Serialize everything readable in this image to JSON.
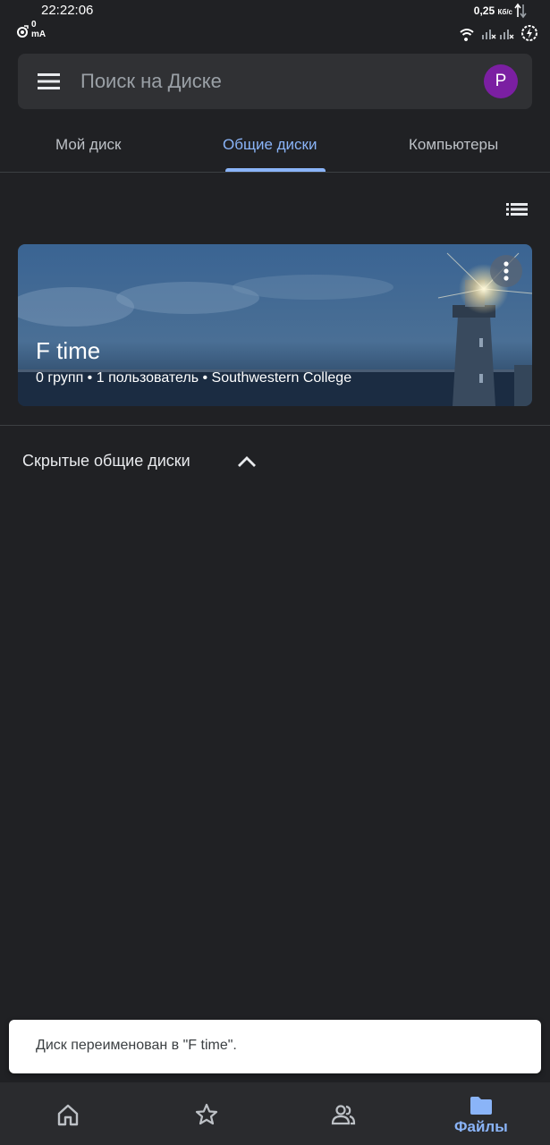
{
  "status_bar": {
    "time": "22:22:06",
    "current_value": "0",
    "current_unit": "mA",
    "net_speed": "0,25",
    "net_speed_unit": "Кб/с",
    "icons": [
      "wifi-icon",
      "signal-icon",
      "signal-icon",
      "battery-charging-icon"
    ]
  },
  "search": {
    "placeholder": "Поиск на Диске",
    "avatar_letter": "P",
    "avatar_color": "#7b1fa2"
  },
  "tabs": [
    {
      "label": "Мой диск",
      "active": false
    },
    {
      "label": "Общие диски",
      "active": true
    },
    {
      "label": "Компьютеры",
      "active": false
    }
  ],
  "shared_drive": {
    "name": "F time",
    "meta": "0 групп • 1 пользователь • Southwestern College"
  },
  "hidden_section": {
    "title": "Скрытые общие диски"
  },
  "snackbar": {
    "message": "Диск переименован в \"F time\"."
  },
  "bottom_nav": [
    {
      "icon": "home-icon",
      "label": ""
    },
    {
      "icon": "star-icon",
      "label": ""
    },
    {
      "icon": "people-icon",
      "label": ""
    },
    {
      "icon": "folder-icon",
      "label": "Файлы",
      "active": true
    }
  ],
  "colors": {
    "background": "#202124",
    "accent": "#8ab4f8",
    "surface": "#303134"
  }
}
